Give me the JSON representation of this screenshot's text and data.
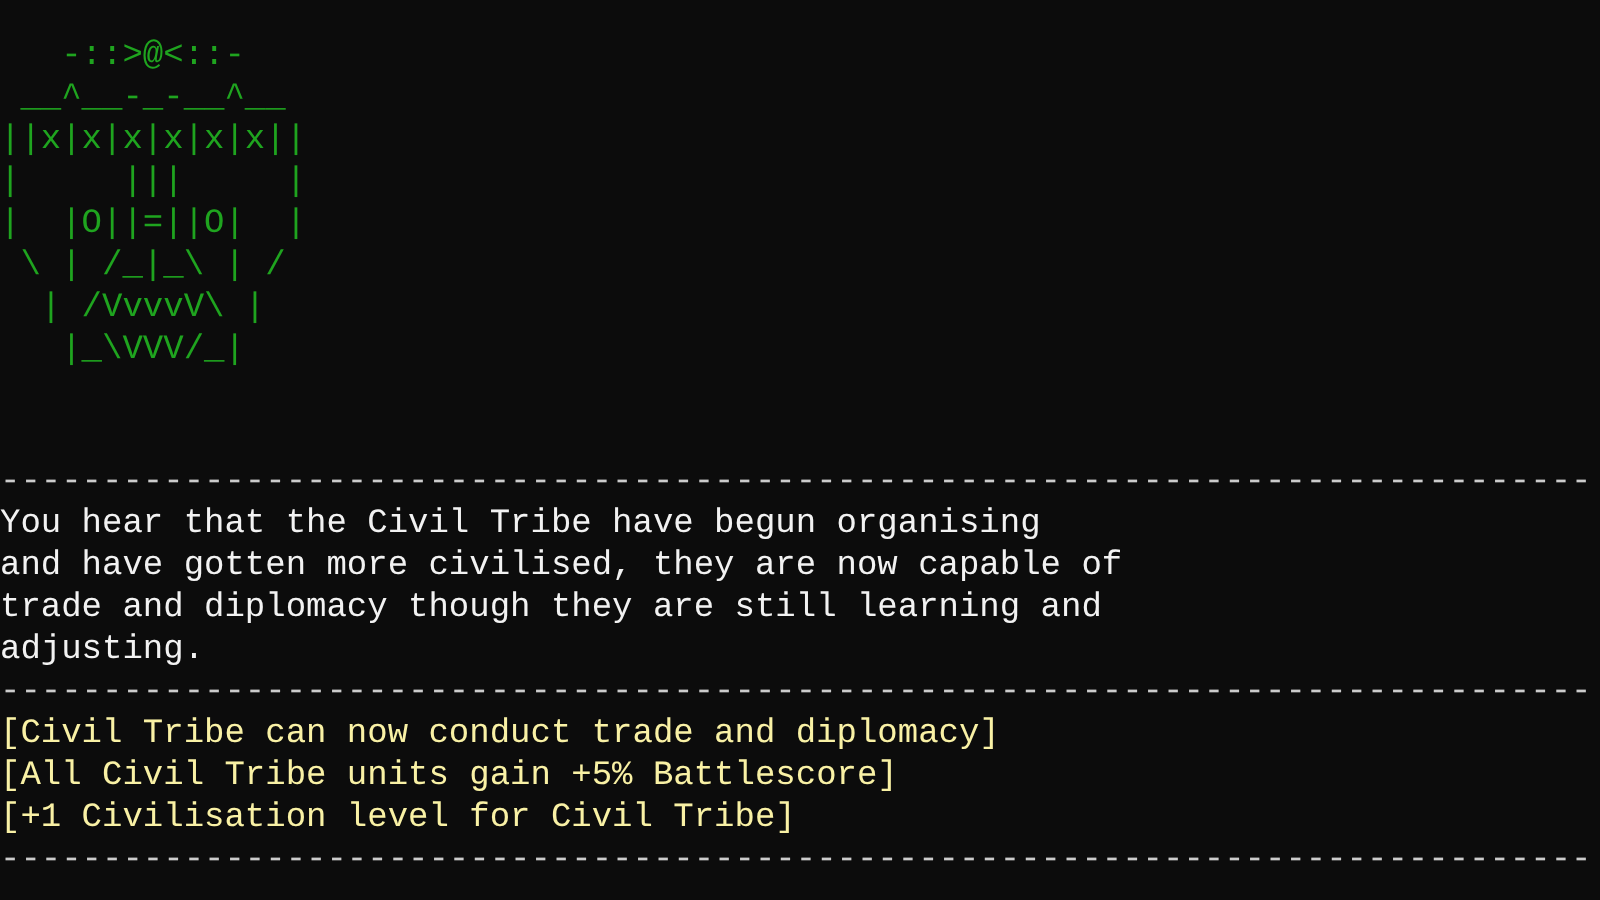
{
  "blocks": [
    {
      "kind": "art",
      "lines": [
        "   -::>@<::-",
        " __^__-_-__^__",
        "||x|x|x|x|x|x||",
        "|     |||     |",
        "|  |O||=||O|  |",
        " \\ | /_|_\\ | /",
        "  | /VvvvV\\ |",
        "   |_\\VVV/_|"
      ]
    },
    {
      "kind": "rule",
      "lines": [
        "------------------------------------------------------------------------------"
      ]
    },
    {
      "kind": "message",
      "lines": [
        "You hear that the Civil Tribe have begun organising",
        "and have gotten more civilised, they are now capable of",
        "trade and diplomacy though they are still learning and",
        "adjusting."
      ]
    },
    {
      "kind": "rule",
      "lines": [
        "------------------------------------------------------------------------------"
      ]
    },
    {
      "kind": "notice",
      "lines": [
        "[Civil Tribe can now conduct trade and diplomacy]",
        "[All Civil Tribe units gain +5% Battlescore]",
        "[+1 Civilisation level for Civil Tribe]"
      ]
    },
    {
      "kind": "rule",
      "lines": [
        "------------------------------------------------------------------------------"
      ]
    }
  ]
}
